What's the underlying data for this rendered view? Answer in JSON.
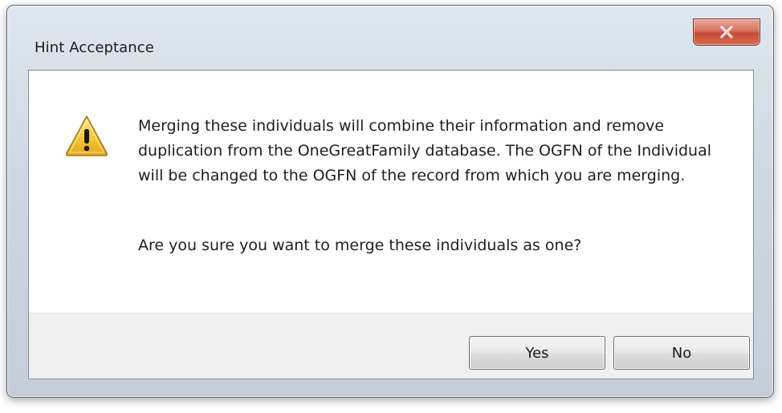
{
  "dialog": {
    "title": "Hint Acceptance",
    "close_icon": "close-icon",
    "warning_icon": "warning-icon",
    "message": "Merging these individuals will combine their information and remove duplication from the OneGreatFamily database. The OGFN of the Individual will be changed to the OGFN of the record from which you are merging.",
    "question": "Are you sure you want to merge these individuals as one?",
    "buttons": {
      "yes_label": "Yes",
      "no_label": "No"
    }
  },
  "colors": {
    "frame": "#cfd9e3",
    "close_button": "#c64a33",
    "warning_fill": "#f2c230",
    "footer": "#f0f0f0"
  }
}
